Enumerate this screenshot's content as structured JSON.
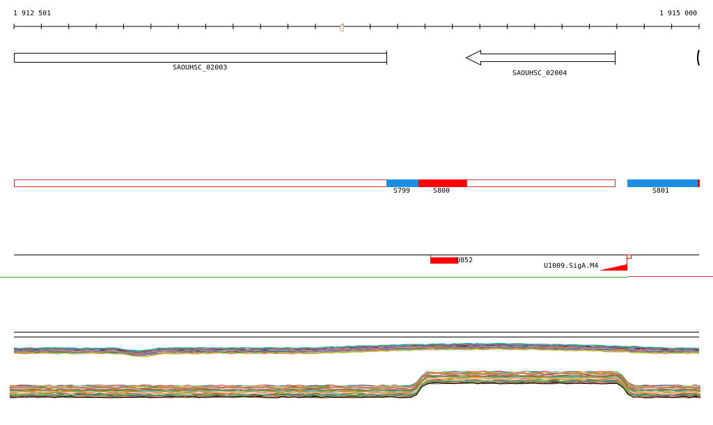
{
  "ruler": {
    "start_label": "1 912 501",
    "end_label": "1 915 000"
  },
  "genes": [
    {
      "name": "SAOUHSC_02003",
      "strand": "+"
    },
    {
      "name": "SAOUHSC_02004",
      "strand": "-"
    }
  ],
  "segments": [
    {
      "name": "S799",
      "color": "#1a8fe3"
    },
    {
      "name": "S800",
      "color": "#ff0000"
    },
    {
      "name": "S801",
      "color": "#1a8fe3"
    }
  ],
  "features": {
    "utr_label": "U852",
    "sigma_label": "U1009.SigA.M4"
  },
  "colors": {
    "segment_outline": "#e03030",
    "feature_red": "#ff0000",
    "divider_green": "#2ca02c",
    "divider_red": "#e03030"
  }
}
